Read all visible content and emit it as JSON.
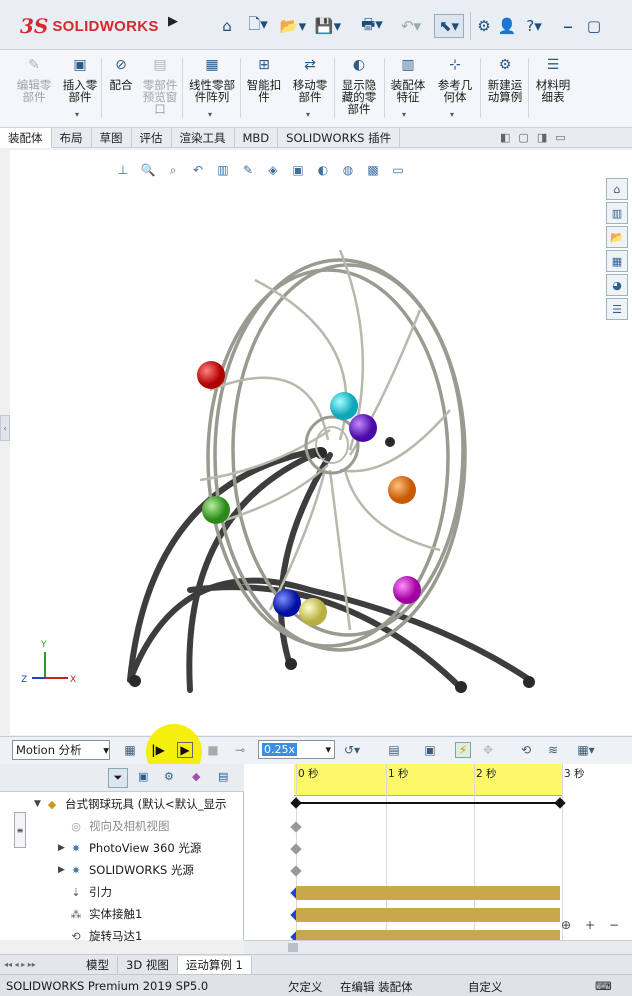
{
  "app": {
    "brand_mark": "3S",
    "brand": "SOLIDWORKS",
    "status_text": "SOLIDWORKS Premium 2019 SP5.0"
  },
  "quick_access": [
    {
      "name": "home",
      "icon": "home-icon"
    },
    {
      "name": "new",
      "icon": "new-document-icon"
    },
    {
      "name": "open",
      "icon": "open-folder-icon"
    },
    {
      "name": "save",
      "icon": "save-icon"
    },
    {
      "name": "print",
      "icon": "print-icon"
    },
    {
      "name": "undo",
      "icon": "undo-icon"
    },
    {
      "name": "select",
      "icon": "select-cursor-icon"
    },
    {
      "name": "options",
      "icon": "options-icon"
    },
    {
      "name": "user",
      "icon": "user-icon"
    },
    {
      "name": "help",
      "icon": "help-icon"
    }
  ],
  "help_label": "?",
  "ribbon": {
    "buttons": [
      {
        "label": "编辑零\n部件",
        "disabled": true,
        "icon": "edit-component-icon"
      },
      {
        "label": "插入零\n部件",
        "disabled": false,
        "icon": "insert-component-icon"
      },
      {
        "label": "配合",
        "disabled": false,
        "icon": "mate-icon"
      },
      {
        "label": "零部件\n预览窗\n口",
        "disabled": true,
        "icon": "component-preview-icon"
      },
      {
        "label": "线性零部\n件阵列",
        "disabled": false,
        "icon": "linear-pattern-icon"
      },
      {
        "label": "智能扣\n件",
        "disabled": false,
        "icon": "smart-fastener-icon"
      },
      {
        "label": "移动零\n部件",
        "disabled": false,
        "icon": "move-component-icon"
      },
      {
        "label": "显示隐\n藏的零\n部件",
        "disabled": false,
        "icon": "show-hidden-icon"
      },
      {
        "label": "装配体\n特征",
        "disabled": false,
        "icon": "assembly-feature-icon"
      },
      {
        "label": "参考几\n何体",
        "disabled": false,
        "icon": "reference-geometry-icon"
      },
      {
        "label": "新建运\n动算例",
        "disabled": false,
        "icon": "new-motion-study-icon"
      },
      {
        "label": "材料明\n细表",
        "disabled": false,
        "icon": "bom-icon"
      }
    ]
  },
  "tabs": [
    "装配体",
    "布局",
    "草图",
    "评估",
    "渲染工具",
    "MBD",
    "SOLIDWORKS 插件"
  ],
  "active_tab": "装配体",
  "motion": {
    "study_type": "Motion 分析",
    "speed": "0.25x",
    "ruler_labels": [
      "0 秒",
      "1 秒",
      "2 秒",
      "3 秒"
    ]
  },
  "tree": {
    "items": [
      {
        "label": "台式钢球玩具 (默认<默认_显示",
        "icon": "assembly-icon",
        "expand": "▼",
        "dim": false
      },
      {
        "label": "视向及相机视图",
        "icon": "camera-view-icon",
        "expand": "",
        "dim": true
      },
      {
        "label": "PhotoView 360 光源",
        "icon": "light-icon",
        "expand": "▶",
        "dim": false
      },
      {
        "label": "SOLIDWORKS 光源",
        "icon": "light-icon",
        "expand": "▶",
        "dim": false
      },
      {
        "label": "引力",
        "icon": "gravity-icon",
        "expand": "",
        "dim": false
      },
      {
        "label": "实体接触1",
        "icon": "contact-icon",
        "expand": "",
        "dim": false
      },
      {
        "label": "旋转马达1",
        "icon": "motor-icon",
        "expand": "",
        "dim": false
      }
    ]
  },
  "bottom_tabs": [
    "模型",
    "3D 视图",
    "运动算例 1"
  ],
  "active_bottom_tab": "运动算例 1",
  "status": {
    "state1": "欠定义",
    "state2": "在编辑 装配体",
    "units": "自定义"
  },
  "axes": {
    "x": "X",
    "y": "Y",
    "z": "Z"
  },
  "colors": {
    "accent": "#d7282f",
    "timeline_ruler": "#fdf86a",
    "timeline_bar": "#c8a84a",
    "cursor_highlight": "#f4ee00"
  }
}
